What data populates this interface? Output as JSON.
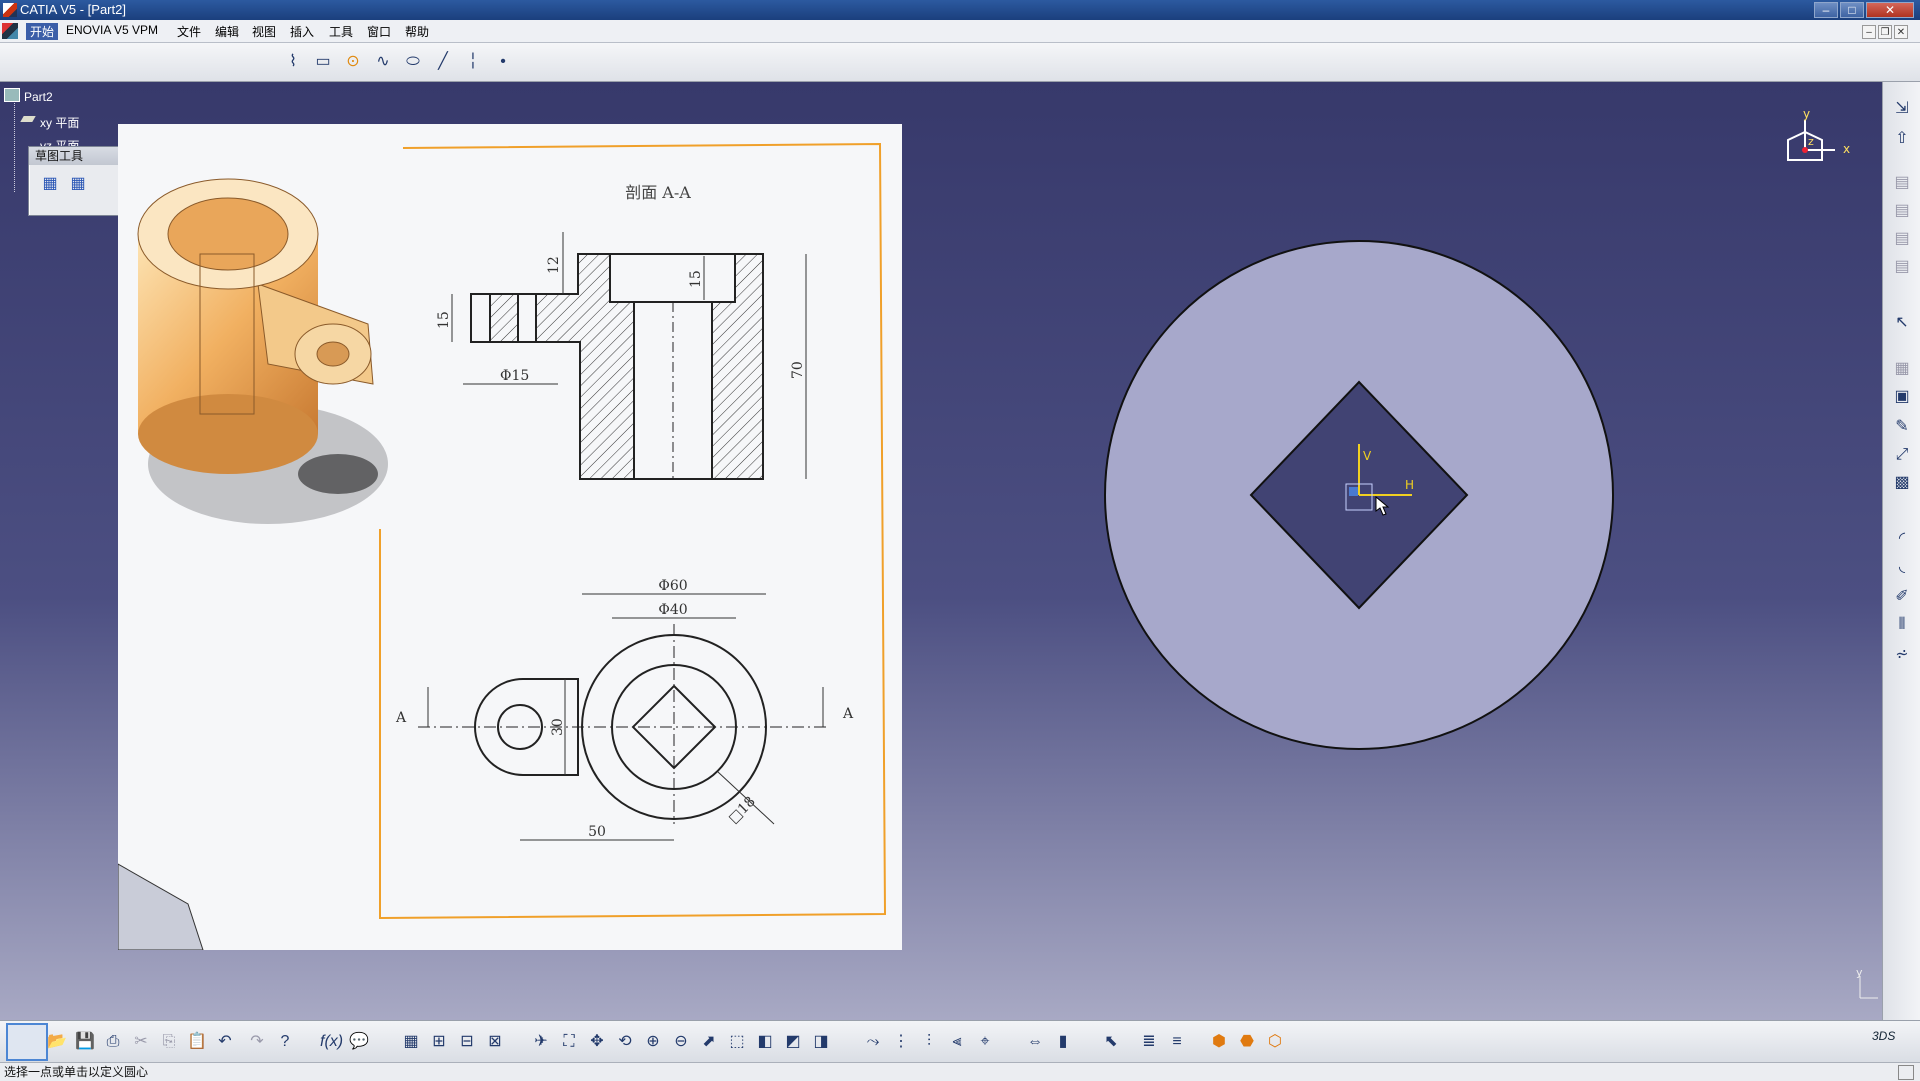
{
  "window": {
    "title": "CATIA V5 - [Part2]",
    "min_label": "–",
    "max_label": "□",
    "close_label": "✕"
  },
  "menubar": {
    "items": [
      "开始",
      "ENOVIA V5 VPM",
      "文件",
      "编辑",
      "视图",
      "插入",
      "工具",
      "窗口",
      "帮助"
    ]
  },
  "tree": {
    "root": "Part2",
    "items": [
      "xy 平面",
      "yz 平面"
    ]
  },
  "sketch_tools": {
    "title": "草图工具"
  },
  "drawing": {
    "section_title": "剖面 A-A",
    "dims": {
      "d12": "12",
      "d15_top": "15",
      "d15_left": "15",
      "d70": "70",
      "phi15": "Φ15",
      "phi60": "Φ60",
      "phi40": "Φ40",
      "d30": "30",
      "d50": "50",
      "sq18": "□18",
      "section_mark_left": "A",
      "section_mark_right": "A"
    }
  },
  "compass": {
    "x": "x",
    "y": "y",
    "z": "z"
  },
  "sketch_axes": {
    "h": "H",
    "v": "V"
  },
  "corner_axis": {
    "y": "y"
  },
  "status": {
    "message": "选择一点或单击以定义圆心"
  },
  "colors": {
    "viewport_top": "#37396b",
    "viewport_bottom": "#a8a9c4",
    "disc_fill": "#a7a8cb",
    "frame_orange": "#f0a02a"
  },
  "icons": {
    "top_toolbar": [
      "profile-icon",
      "rectangle-icon",
      "circle-icon",
      "spline-icon",
      "ellipse-icon",
      "line-icon",
      "axis-icon",
      "point-icon"
    ],
    "right_toolbar": [
      "exit-workbench-icon",
      "sketch-icon",
      "select-icon",
      "constraint-icon",
      "corner-icon",
      "trim-icon",
      "mirror-icon",
      "project-icon"
    ],
    "bottom_toolbar": [
      "new-icon",
      "open-icon",
      "save-icon",
      "print-icon",
      "cut-icon",
      "copy-icon",
      "paste-icon",
      "undo-icon",
      "redo-icon",
      "help-icon",
      "formula-icon",
      "fit-all-icon",
      "pan-icon",
      "rotate-icon",
      "zoom-in-icon",
      "zoom-out-icon",
      "normal-view-icon",
      "iso-view-icon",
      "shading-icon",
      "hide-show-icon"
    ]
  }
}
